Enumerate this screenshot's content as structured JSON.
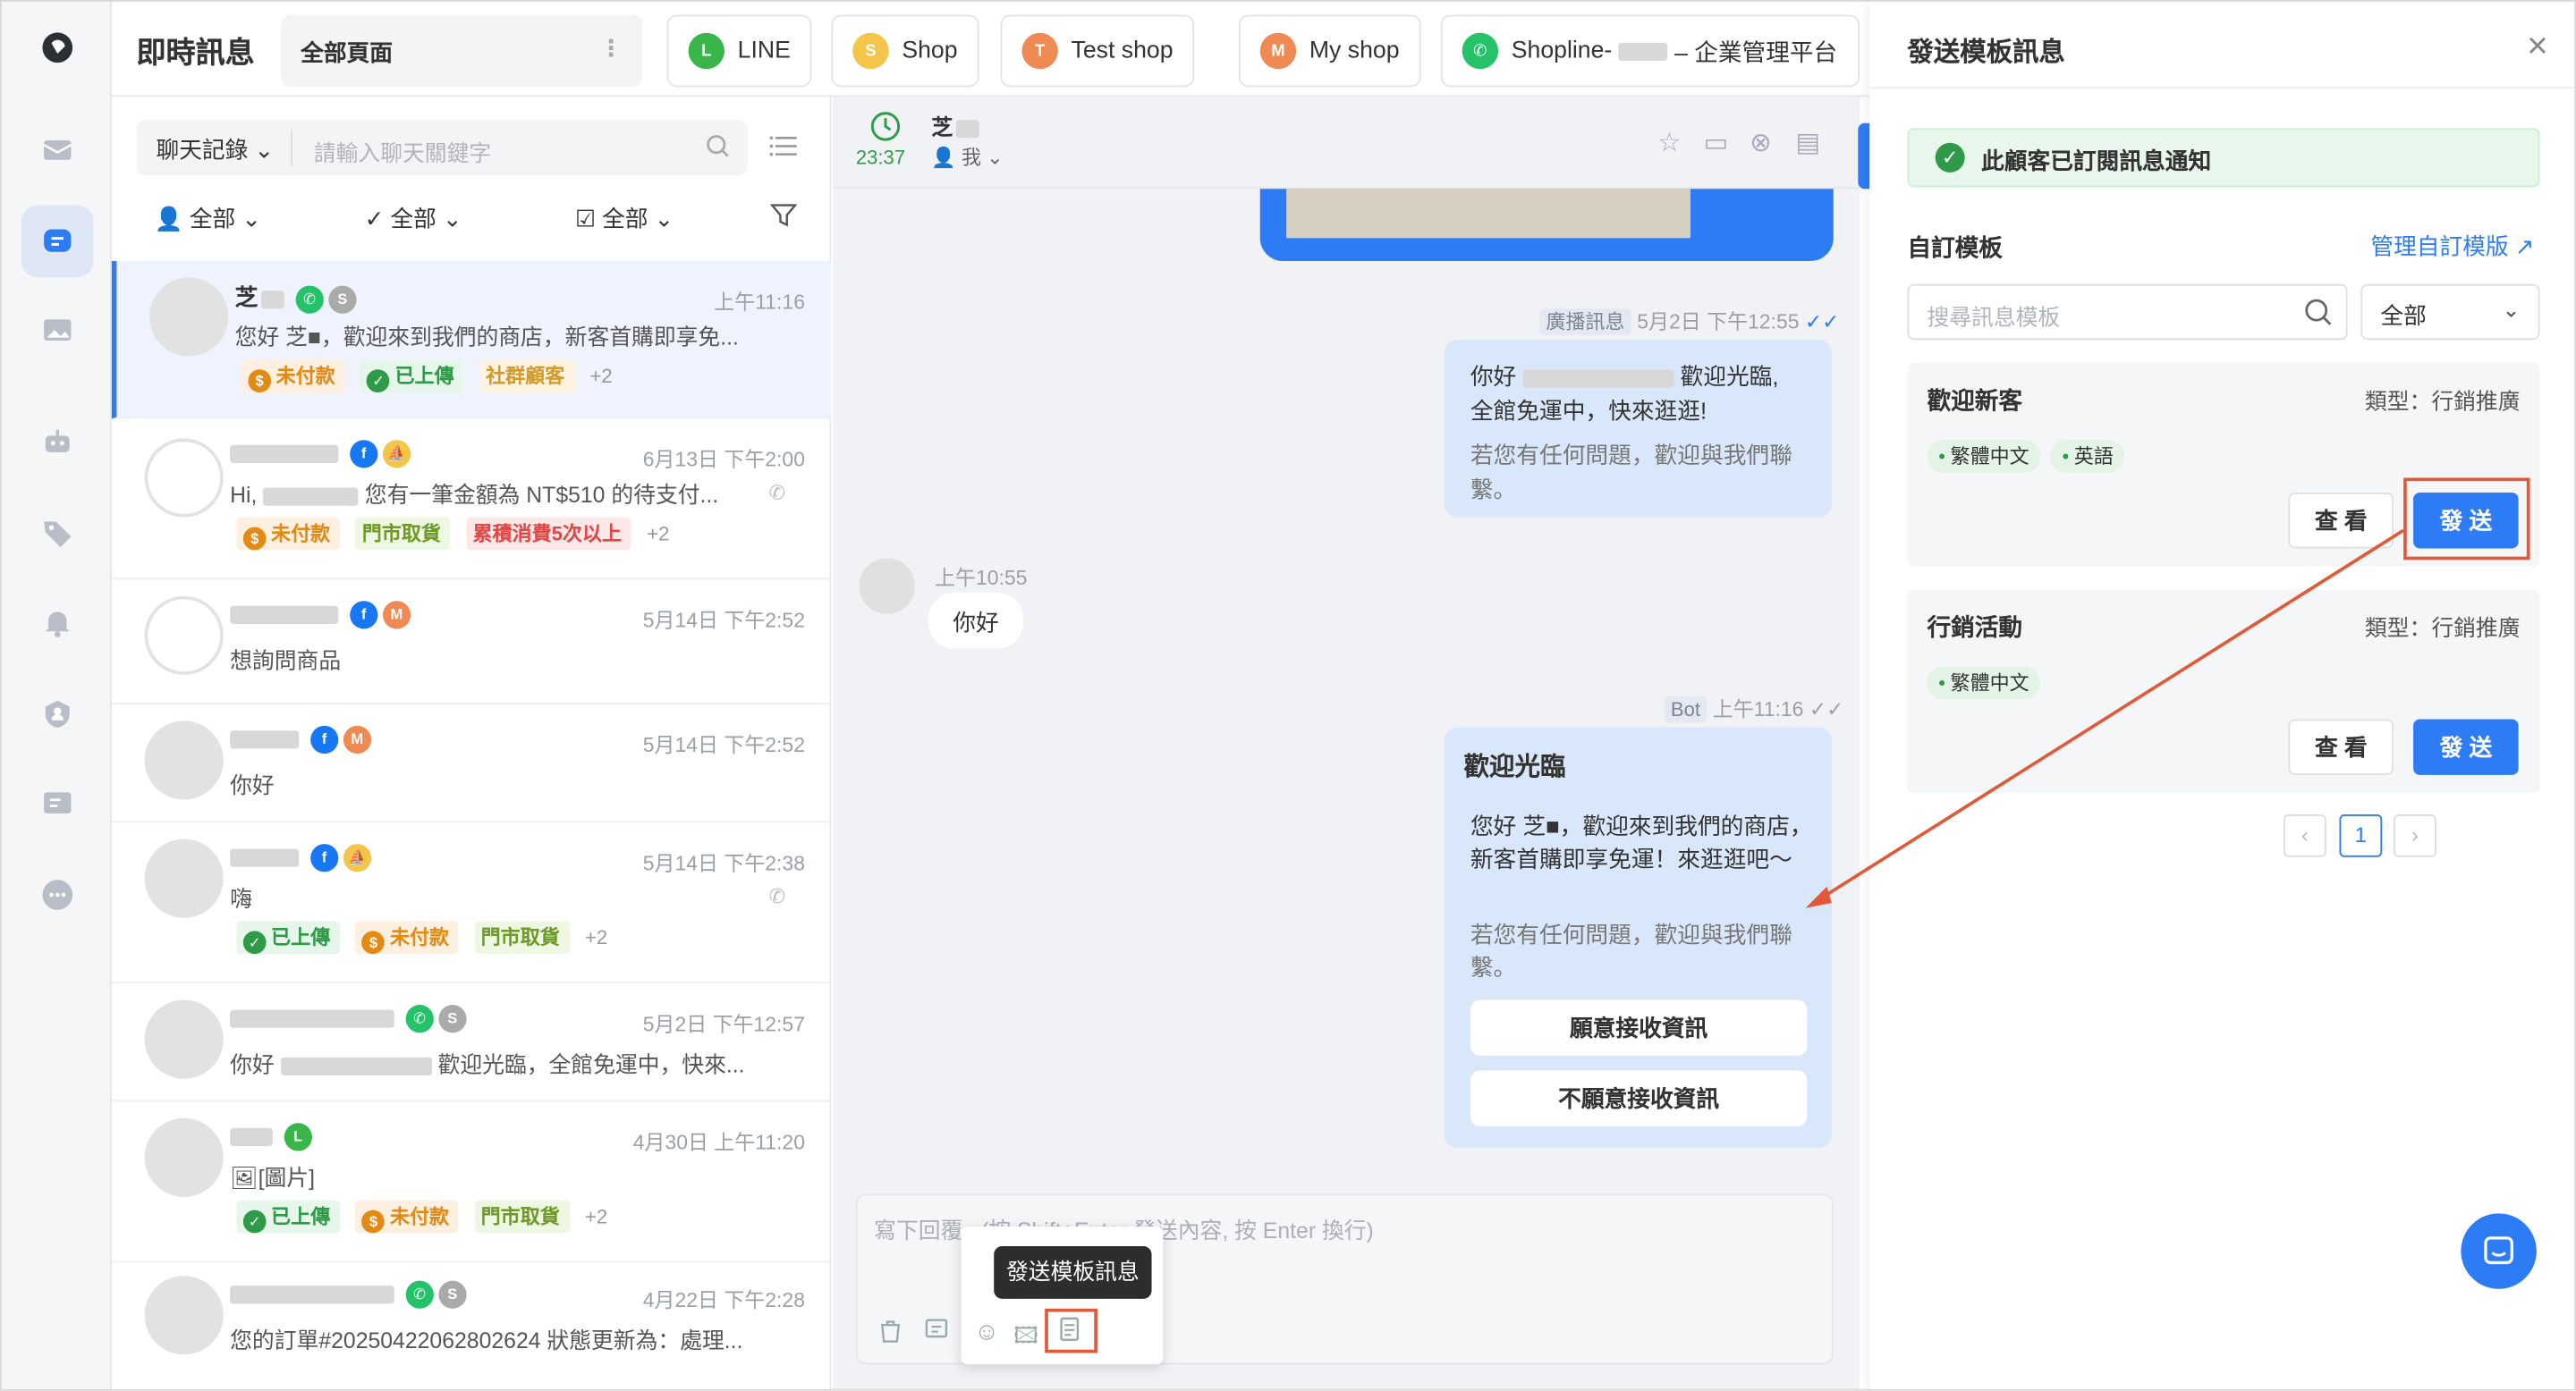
{
  "app_title": "即時訊息",
  "page_select": "全部頁面",
  "channels": [
    {
      "label": "LINE",
      "icon": "line-icon",
      "color": "#39b54a"
    },
    {
      "label": "Shop",
      "icon": "shop-icon",
      "color": "#f3c64a"
    },
    {
      "label": "Test shop",
      "icon": "test-shop-icon",
      "color": "#f08a55"
    },
    {
      "label": "My shop",
      "icon": "my-shop-icon",
      "color": "#f08a55"
    },
    {
      "label": "Shopline-",
      "suffix": " – 企業管理平台",
      "icon": "whatsapp-icon",
      "color": "#25c26a"
    }
  ],
  "list": {
    "history_label": "聊天記錄",
    "search_placeholder": "請輸入聊天關鍵字",
    "filters": [
      "全部",
      "全部",
      "全部"
    ]
  },
  "conversations": [
    {
      "name": "芝",
      "time": "上午11:16",
      "msg": "您好 芝■，歡迎來到我們的商店，新客首購即享免...",
      "tags": [
        "未付款",
        "已上傳",
        "社群顧客"
      ],
      "more": "+2"
    },
    {
      "name": "",
      "time": "6月13日 下午2:00",
      "msg_pre": "Hi,",
      "msg": "您有一筆金額為 NT$510 的待支付...",
      "tags": [
        "未付款",
        "門市取貨",
        "累積消費5次以上"
      ],
      "more": "+2"
    },
    {
      "name": "",
      "time": "5月14日 下午2:52",
      "msg": "想詢問商品",
      "tags": [],
      "more": ""
    },
    {
      "name": "",
      "time": "5月14日 下午2:52",
      "msg": "你好",
      "tags": [],
      "more": ""
    },
    {
      "name": "",
      "time": "5月14日 下午2:38",
      "msg": "嗨",
      "tags": [
        "已上傳",
        "未付款",
        "門市取貨"
      ],
      "more": "+2"
    },
    {
      "name": "",
      "time": "5月2日 下午12:57",
      "msg_pre": "你好",
      "msg": "歡迎光臨，全館免運中，快來...",
      "tags": [],
      "more": ""
    },
    {
      "name": "",
      "time": "4月30日 上午11:20",
      "msg": "[圖片]",
      "tags": [
        "已上傳",
        "未付款",
        "門市取貨"
      ],
      "more": "+2"
    },
    {
      "name": "",
      "time": "4月22日 下午2:28",
      "msg": "您的訂單#20250422062802624 狀態更新為：處理...",
      "tags": [],
      "more": ""
    }
  ],
  "chat": {
    "timer": "23:37",
    "contact": "芝",
    "assignee": "我",
    "broadcast_badge": "廣播訊息",
    "broadcast_time": "5月2日 下午12:55",
    "broadcast_line1_pre": "你好",
    "broadcast_line1_post": "歡迎光臨,",
    "broadcast_line2": "全館免運中，快來逛逛!",
    "broadcast_line3": "若您有任何問題，歡迎與我們聯繫。",
    "incoming_time": "上午10:55",
    "incoming_msg": "你好",
    "bot_badge": "Bot",
    "bot_time": "上午11:16",
    "bot_title": "歡迎光臨",
    "bot_body": "您好 芝■，歡迎來到我們的商店，新客首購即享免運！來逛逛吧～",
    "bot_note": "若您有任何問題，歡迎與我們聯繫。",
    "bot_btn_yes": "願意接收資訊",
    "bot_btn_no": "不願意接收資訊",
    "input_placeholder": "寫下回覆...(按 Shift+Enter 發送內容, 按 Enter 換行)",
    "tooltip": "發送模板訊息"
  },
  "panel": {
    "title": "發送模板訊息",
    "notice": "此顧客已訂閱訊息通知",
    "section": "自訂模板",
    "manage_link": "管理自訂模版",
    "search_placeholder": "搜尋訊息模板",
    "filter_value": "全部",
    "templates": [
      {
        "title": "歡迎新客",
        "type": "類型：行銷推廣",
        "langs": [
          "繁體中文",
          "英語"
        ],
        "view": "查 看",
        "send": "發 送"
      },
      {
        "title": "行銷活動",
        "type": "類型：行銷推廣",
        "langs": [
          "繁體中文"
        ],
        "view": "查 看",
        "send": "發 送"
      }
    ],
    "page": "1"
  },
  "colors": {
    "accent": "#2d7cf6",
    "annotation": "#e05a3a",
    "success": "#2f9b48"
  }
}
